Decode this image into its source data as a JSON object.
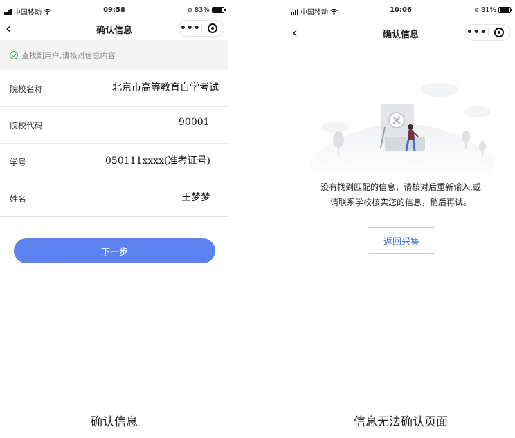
{
  "left_screen": {
    "status": {
      "carrier": "中国移动",
      "time": "09:58",
      "battery": "83%",
      "battery_level": 0.83
    },
    "nav": {
      "title": "确认信息",
      "more_label": "•••"
    },
    "notice": "查找到用户,请核对信息内容",
    "fields": [
      {
        "label": "院校名称",
        "value": "北京市高等教育自学考试"
      },
      {
        "label": "院校代码",
        "value": "90001"
      },
      {
        "label": "学号",
        "value": "050111xxxx(准考证号)"
      },
      {
        "label": "姓名",
        "value": "王梦梦"
      }
    ],
    "next_button": "下一步",
    "caption": "确认信息"
  },
  "right_screen": {
    "status": {
      "carrier": "中国移动",
      "time": "10:06",
      "battery": "81%",
      "battery_level": 0.81
    },
    "nav": {
      "title": "确认信息",
      "more_label": "•••"
    },
    "message_line1": "没有找到匹配的信息，请核对后重新输入,或",
    "message_line2": "请联系学校核实您的信息，稍后再试。",
    "back_button": "返回采集",
    "caption": "信息无法确认页面"
  },
  "colors": {
    "primary": "#5b82ef",
    "success": "#3aa94a",
    "link": "#4a76d3"
  },
  "icons": [
    "signal-icon",
    "wifi-icon",
    "battery-icon",
    "back-chevron-icon",
    "more-icon",
    "close-capsule-icon",
    "check-circle-icon",
    "no-result-illustration"
  ]
}
